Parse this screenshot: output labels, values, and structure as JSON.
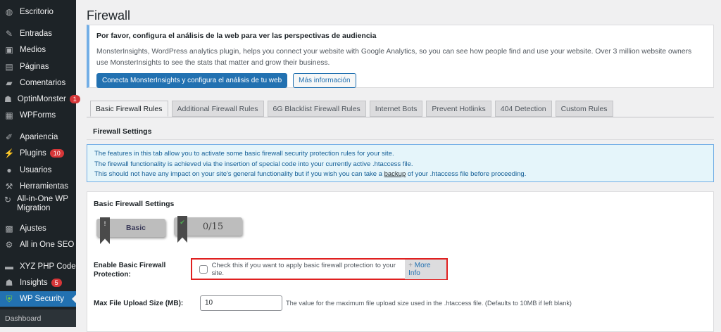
{
  "sidebar": {
    "items": [
      {
        "label": "Escritorio",
        "icon": "dashboard-icon"
      },
      {
        "label": "Entradas",
        "icon": "pin-icon"
      },
      {
        "label": "Medios",
        "icon": "media-icon"
      },
      {
        "label": "Páginas",
        "icon": "pages-icon"
      },
      {
        "label": "Comentarios",
        "icon": "comment-icon"
      },
      {
        "label": "OptinMonster",
        "icon": "monster-icon",
        "badge": "1"
      },
      {
        "label": "WPForms",
        "icon": "forms-icon"
      },
      {
        "label": "Apariencia",
        "icon": "brush-icon"
      },
      {
        "label": "Plugins",
        "icon": "plugin-icon",
        "badge": "10"
      },
      {
        "label": "Usuarios",
        "icon": "user-icon"
      },
      {
        "label": "Herramientas",
        "icon": "wrench-icon"
      },
      {
        "label": "All-in-One WP Migration",
        "icon": "migration-icon"
      },
      {
        "label": "Ajustes",
        "icon": "settings-icon"
      },
      {
        "label": "All in One SEO",
        "icon": "seo-icon"
      },
      {
        "label": "XYZ PHP Code",
        "icon": "php-icon"
      },
      {
        "label": "Insights",
        "icon": "insights-icon",
        "badge": "5"
      },
      {
        "label": "WP Security",
        "icon": "shield-icon"
      }
    ],
    "submenu": "Dashboard"
  },
  "page": {
    "title": "Firewall"
  },
  "notice": {
    "title": "Por favor, configura el análisis de la web para ver las perspectivas de audiencia",
    "body": "MonsterInsights, WordPress analytics plugin, helps you connect your website with Google Analytics, so you can see how people find and use your website. Over 3 million website owners use MonsterInsights to see the stats that matter and grow their business.",
    "primary": "Conecta MonsterInsights y configura el análisis de tu web",
    "secondary": "Más información"
  },
  "tabs": [
    "Basic Firewall Rules",
    "Additional Firewall Rules",
    "6G Blacklist Firewall Rules",
    "Internet Bots",
    "Prevent Hotlinks",
    "404 Detection",
    "Custom Rules"
  ],
  "section_title": "Firewall Settings",
  "info": {
    "line1": "The features in this tab allow you to activate some basic firewall security protection rules for your site.",
    "line2": "The firewall functionality is achieved via the insertion of special code into your currently active .htaccess file.",
    "line3a": "This should not have any impact on your site's general functionality but if you wish you can take a ",
    "link": "backup",
    "line3b": " of your .htaccess file before proceeding."
  },
  "panel": {
    "title": "Basic Firewall Settings",
    "level": "Basic",
    "score": "0/15",
    "enable_label": "Enable Basic Firewall Protection:",
    "enable_checked": false,
    "enable_desc": "Check this if you want to apply basic firewall protection to your site.",
    "more_info": "More Info",
    "more_info_icon": "+",
    "upload_label": "Max File Upload Size (MB):",
    "upload_value": "10",
    "upload_desc": "The value for the maximum file upload size used in the .htaccess file. (Defaults to 10MB if left blank)"
  }
}
